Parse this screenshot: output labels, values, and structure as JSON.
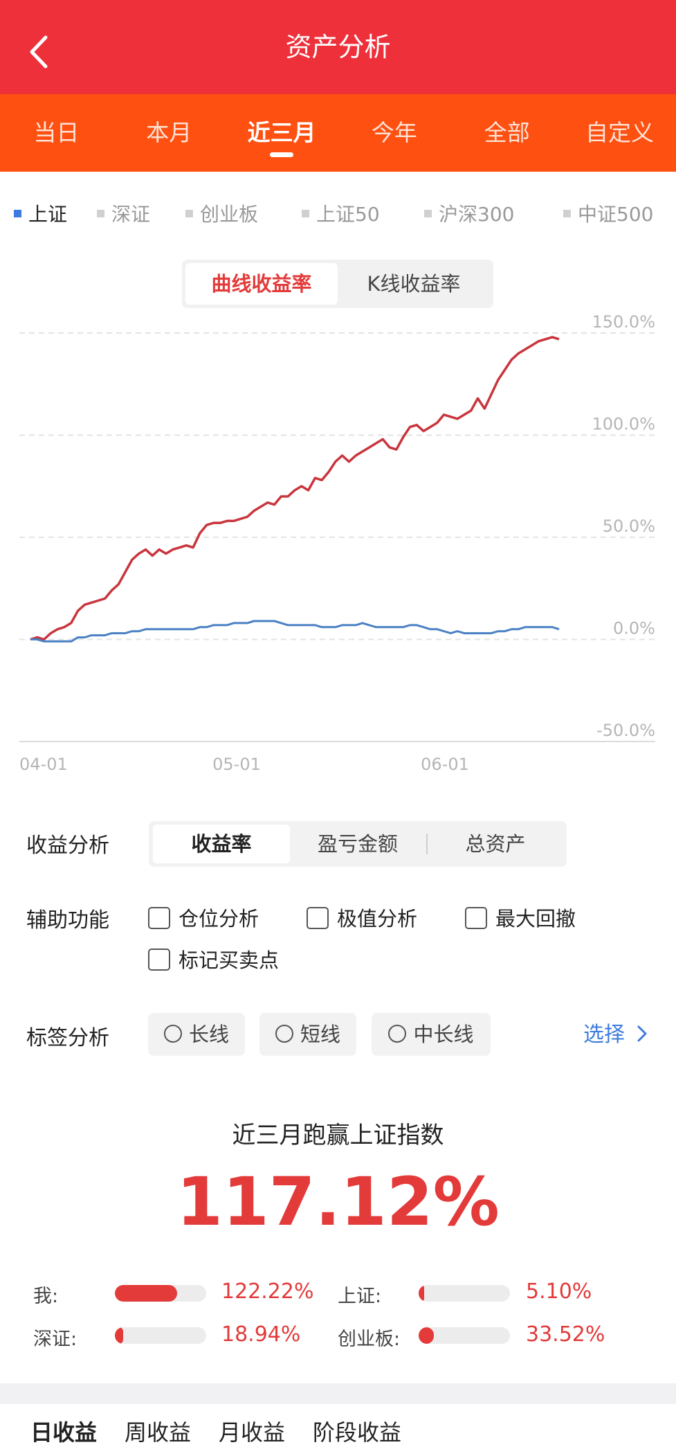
{
  "header": {
    "title": "资产分析"
  },
  "tabs": [
    {
      "label": "当日",
      "active": false
    },
    {
      "label": "本月",
      "active": false
    },
    {
      "label": "近三月",
      "active": true
    },
    {
      "label": "今年",
      "active": false
    },
    {
      "label": "全部",
      "active": false
    },
    {
      "label": "自定义",
      "active": false
    }
  ],
  "indices": [
    {
      "label": "上证",
      "active": true
    },
    {
      "label": "深证",
      "active": false
    },
    {
      "label": "创业板",
      "active": false
    },
    {
      "label": "上证50",
      "active": false
    },
    {
      "label": "沪深300",
      "active": false
    },
    {
      "label": "中证500",
      "active": false
    }
  ],
  "chart_mode": {
    "curve": "曲线收益率",
    "kline": "K线收益率"
  },
  "colors": {
    "header": "#ee303b",
    "tabs": "#fe5011",
    "accent": "#e33a3a",
    "blue": "#3d7bde"
  },
  "chart_data": {
    "type": "line",
    "y_ticks": [
      "150.0%",
      "100.0%",
      "50.0%",
      "0.0%",
      "-50.0%"
    ],
    "ylim": [
      -50,
      150
    ],
    "x_ticks": [
      "04-01",
      "05-01",
      "06-01"
    ],
    "grid": true,
    "series": [
      {
        "color": "#c9353d",
        "x": [
          0,
          1,
          2,
          3,
          4,
          5,
          6,
          7,
          8,
          9,
          10,
          11,
          12,
          13,
          14,
          15,
          16,
          17,
          18,
          19,
          20,
          21,
          22,
          23,
          24,
          25,
          26,
          27,
          28,
          29,
          30,
          31,
          32,
          33,
          34,
          35,
          36,
          37,
          38,
          39,
          40,
          41,
          42,
          43,
          44,
          45,
          46,
          47,
          48,
          49,
          50,
          51,
          52,
          53,
          54,
          55,
          56,
          57,
          58,
          59,
          60,
          61,
          62,
          63,
          64,
          65,
          66,
          67,
          68,
          69,
          70,
          71,
          72,
          73,
          74,
          75,
          76,
          77,
          78
        ],
        "values": [
          0,
          1,
          0,
          3,
          5,
          6,
          8,
          14,
          17,
          18,
          19,
          20,
          24,
          27,
          33,
          39,
          42,
          44,
          41,
          44,
          42,
          44,
          45,
          46,
          45,
          52,
          56,
          57,
          57,
          58,
          58,
          59,
          60,
          63,
          65,
          67,
          66,
          70,
          70,
          73,
          75,
          73,
          79,
          78,
          82,
          87,
          90,
          87,
          90,
          92,
          94,
          96,
          98,
          94,
          93,
          99,
          104,
          105,
          102,
          104,
          106,
          110,
          109,
          108,
          110,
          112,
          118,
          113,
          120,
          127,
          132,
          137,
          140,
          142,
          144,
          146,
          147,
          148,
          147
        ],
        "note": "portfolio"
      },
      {
        "color": "#4a80c4",
        "x": [
          0,
          1,
          2,
          3,
          4,
          5,
          6,
          7,
          8,
          9,
          10,
          11,
          12,
          13,
          14,
          15,
          16,
          17,
          18,
          19,
          20,
          21,
          22,
          23,
          24,
          25,
          26,
          27,
          28,
          29,
          30,
          31,
          32,
          33,
          34,
          35,
          36,
          37,
          38,
          39,
          40,
          41,
          42,
          43,
          44,
          45,
          46,
          47,
          48,
          49,
          50,
          51,
          52,
          53,
          54,
          55,
          56,
          57,
          58,
          59,
          60,
          61,
          62,
          63,
          64,
          65,
          66,
          67,
          68,
          69,
          70,
          71,
          72,
          73,
          74,
          75,
          76,
          77,
          78
        ],
        "values": [
          0,
          0,
          -1,
          -1,
          -1,
          -1,
          -1,
          1,
          1,
          2,
          2,
          2,
          3,
          3,
          3,
          4,
          4,
          5,
          5,
          5,
          5,
          5,
          5,
          5,
          5,
          6,
          6,
          7,
          7,
          7,
          8,
          8,
          8,
          9,
          9,
          9,
          9,
          8,
          7,
          7,
          7,
          7,
          7,
          6,
          6,
          6,
          7,
          7,
          7,
          8,
          7,
          6,
          6,
          6,
          6,
          6,
          7,
          7,
          6,
          5,
          5,
          4,
          3,
          4,
          3,
          3,
          3,
          3,
          3,
          4,
          4,
          5,
          5,
          6,
          6,
          6,
          6,
          6,
          5
        ],
        "note": "index"
      }
    ]
  },
  "profit_analysis": {
    "label": "收益分析",
    "options": [
      {
        "label": "收益率",
        "active": true
      },
      {
        "label": "盈亏金额",
        "active": false
      },
      {
        "label": "总资产",
        "active": false
      }
    ]
  },
  "aux": {
    "label": "辅助功能",
    "options": [
      "仓位分析",
      "极值分析",
      "最大回撤",
      "标记买卖点"
    ]
  },
  "tags": {
    "label": "标签分析",
    "options": [
      "长线",
      "短线",
      "中长线"
    ],
    "select": "选择"
  },
  "summary": {
    "title": "近三月跑赢上证指数",
    "value": "117.12%",
    "items": [
      {
        "label": "我:",
        "value": "122.22%",
        "ratio": 0.68
      },
      {
        "label": "上证:",
        "value": "5.10%",
        "ratio": 0.03
      },
      {
        "label": "深证:",
        "value": "18.94%",
        "ratio": 0.09
      },
      {
        "label": "创业板:",
        "value": "33.52%",
        "ratio": 0.17
      }
    ]
  },
  "bottom_tabs": [
    "日收益",
    "周收益",
    "月收益",
    "阶段收益"
  ]
}
